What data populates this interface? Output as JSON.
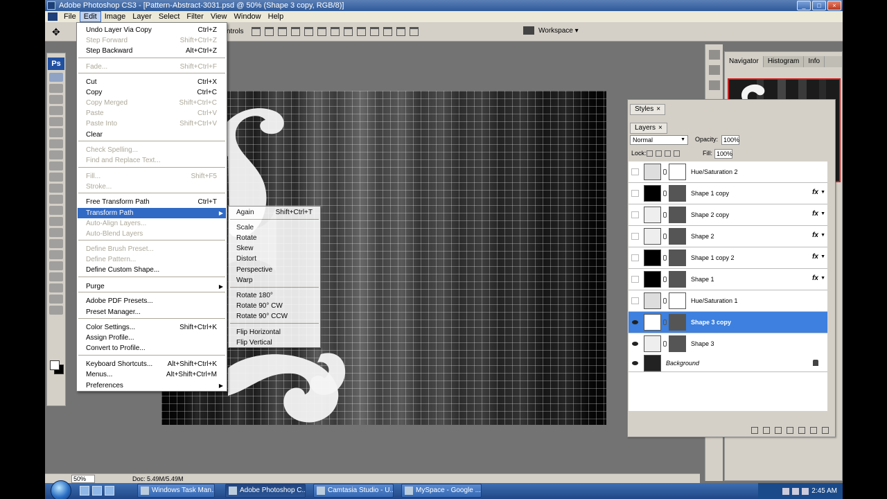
{
  "window": {
    "title": "Adobe Photoshop CS3 - [Pattern-Abstract-3031.psd @ 50% (Shape 3 copy, RGB/8)]",
    "buttons": [
      "_",
      "□",
      "×"
    ]
  },
  "menubar": [
    "File",
    "Edit",
    "Image",
    "Layer",
    "Select",
    "Filter",
    "View",
    "Window",
    "Help"
  ],
  "options": {
    "partial_text": "ntrols",
    "workspace_label": "Workspace ▾"
  },
  "edit_menu": [
    {
      "label": "Undo Layer Via Copy",
      "shortcut": "Ctrl+Z",
      "enabled": true
    },
    {
      "label": "Step Forward",
      "shortcut": "Shift+Ctrl+Z",
      "enabled": false
    },
    {
      "label": "Step Backward",
      "shortcut": "Alt+Ctrl+Z",
      "enabled": true
    },
    {
      "label": "Fade...",
      "shortcut": "Shift+Ctrl+F",
      "enabled": false
    },
    {
      "label": "Cut",
      "shortcut": "Ctrl+X",
      "enabled": true
    },
    {
      "label": "Copy",
      "shortcut": "Ctrl+C",
      "enabled": true
    },
    {
      "label": "Copy Merged",
      "shortcut": "Shift+Ctrl+C",
      "enabled": false
    },
    {
      "label": "Paste",
      "shortcut": "Ctrl+V",
      "enabled": false
    },
    {
      "label": "Paste Into",
      "shortcut": "Shift+Ctrl+V",
      "enabled": false
    },
    {
      "label": "Clear",
      "shortcut": "",
      "enabled": true
    },
    {
      "label": "Check Spelling...",
      "shortcut": "",
      "enabled": false
    },
    {
      "label": "Find and Replace Text...",
      "shortcut": "",
      "enabled": false
    },
    {
      "label": "Fill...",
      "shortcut": "Shift+F5",
      "enabled": false
    },
    {
      "label": "Stroke...",
      "shortcut": "",
      "enabled": false
    },
    {
      "label": "Free Transform Path",
      "shortcut": "Ctrl+T",
      "enabled": true
    },
    {
      "label": "Transform Path",
      "shortcut": "",
      "enabled": true
    },
    {
      "label": "Auto-Align Layers...",
      "shortcut": "",
      "enabled": false
    },
    {
      "label": "Auto-Blend Layers",
      "shortcut": "",
      "enabled": false
    },
    {
      "label": "Define Brush Preset...",
      "shortcut": "",
      "enabled": false
    },
    {
      "label": "Define Pattern...",
      "shortcut": "",
      "enabled": false
    },
    {
      "label": "Define Custom Shape...",
      "shortcut": "",
      "enabled": true
    },
    {
      "label": "Purge",
      "shortcut": "",
      "enabled": true
    },
    {
      "label": "Adobe PDF Presets...",
      "shortcut": "",
      "enabled": true
    },
    {
      "label": "Preset Manager...",
      "shortcut": "",
      "enabled": true
    },
    {
      "label": "Color Settings...",
      "shortcut": "Shift+Ctrl+K",
      "enabled": true
    },
    {
      "label": "Assign Profile...",
      "shortcut": "",
      "enabled": true
    },
    {
      "label": "Convert to Profile...",
      "shortcut": "",
      "enabled": true
    },
    {
      "label": "Keyboard Shortcuts...",
      "shortcut": "Alt+Shift+Ctrl+K",
      "enabled": true
    },
    {
      "label": "Menus...",
      "shortcut": "Alt+Shift+Ctrl+M",
      "enabled": true
    },
    {
      "label": "Preferences",
      "shortcut": "",
      "enabled": true
    }
  ],
  "transform_submenu": [
    {
      "label": "Again",
      "shortcut": "Shift+Ctrl+T"
    },
    {
      "label": "Scale",
      "shortcut": ""
    },
    {
      "label": "Rotate",
      "shortcut": ""
    },
    {
      "label": "Skew",
      "shortcut": ""
    },
    {
      "label": "Distort",
      "shortcut": ""
    },
    {
      "label": "Perspective",
      "shortcut": ""
    },
    {
      "label": "Warp",
      "shortcut": ""
    },
    {
      "label": "Rotate 180°",
      "shortcut": ""
    },
    {
      "label": "Rotate 90° CW",
      "shortcut": ""
    },
    {
      "label": "Rotate 90° CCW",
      "shortcut": ""
    },
    {
      "label": "Flip Horizontal",
      "shortcut": ""
    },
    {
      "label": "Flip Vertical",
      "shortcut": ""
    }
  ],
  "navigator": {
    "tabs": [
      "Navigator",
      "Histogram",
      "Info"
    ]
  },
  "styles_panel": {
    "tab": "Styles"
  },
  "layers_panel": {
    "tab": "Layers",
    "blend_mode": "Normal",
    "opacity_label": "Opacity:",
    "opacity": "100%",
    "lock_label": "Lock:",
    "fill_label": "Fill:",
    "fill": "100%",
    "layers": [
      {
        "name": "Hue/Saturation 2",
        "visible": false,
        "fx": false
      },
      {
        "name": "Shape 1 copy",
        "visible": false,
        "fx": true
      },
      {
        "name": "Shape 2 copy",
        "visible": false,
        "fx": true
      },
      {
        "name": "Shape 2",
        "visible": false,
        "fx": true
      },
      {
        "name": "Shape 1 copy 2",
        "visible": false,
        "fx": true
      },
      {
        "name": "Shape 1",
        "visible": false,
        "fx": true
      },
      {
        "name": "Hue/Saturation 1",
        "visible": false,
        "fx": false
      },
      {
        "name": "Shape 3 copy",
        "visible": true,
        "fx": false,
        "selected": true
      },
      {
        "name": "Shape 3",
        "visible": true,
        "fx": false
      },
      {
        "name": "Background",
        "visible": true,
        "fx": false,
        "locked": true
      }
    ]
  },
  "statusbar": {
    "zoom": "50%",
    "doc": "Doc: 5.49M/5.49M"
  },
  "taskbar": {
    "buttons": [
      {
        "label": "Windows Task Man...",
        "active": false
      },
      {
        "label": "Adobe Photoshop C...",
        "active": true
      },
      {
        "label": "Camtasia Studio - U...",
        "active": false
      },
      {
        "label": "MySpace - Google ...",
        "active": false
      }
    ],
    "clock": "2:45 AM"
  },
  "icons": {
    "ps_logo": "Ps",
    "fx": "fx",
    "submenu_arrow": "▶",
    "dropdown": "▼"
  }
}
